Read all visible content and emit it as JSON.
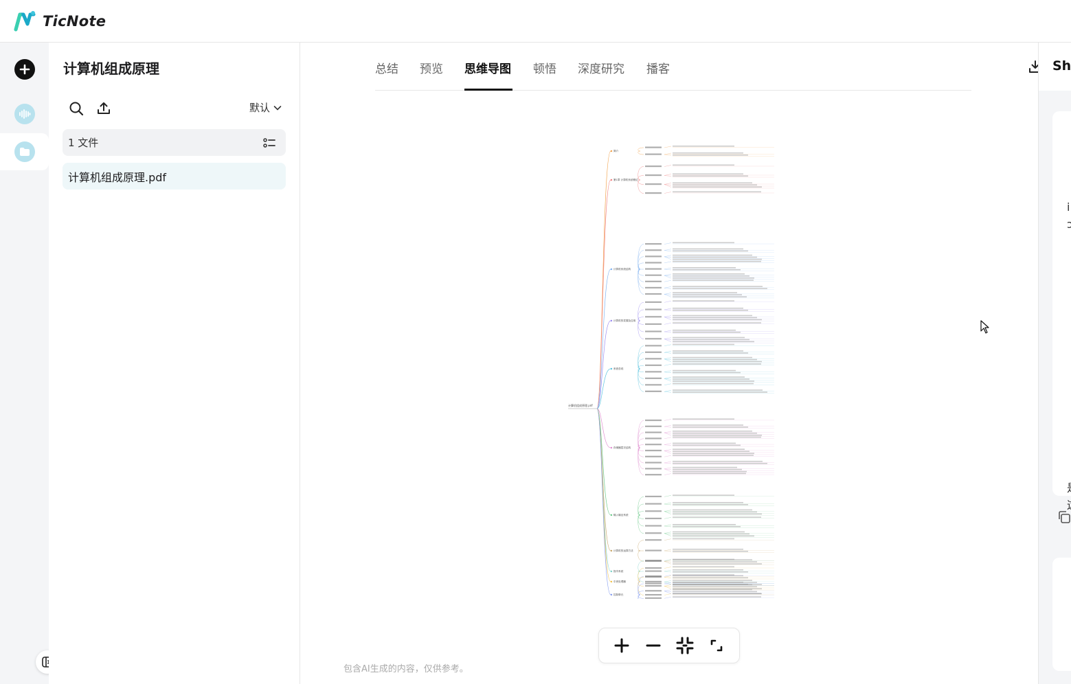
{
  "brand": {
    "name": "TicNote"
  },
  "folder": {
    "title": "计算机组成原理",
    "sort_label": "默认",
    "file_count": "1 文件",
    "files": [
      {
        "name": "计算机组成原理.pdf"
      }
    ]
  },
  "tabs": [
    {
      "label": "总结"
    },
    {
      "label": "预览"
    },
    {
      "label": "思维导图",
      "active": true
    },
    {
      "label": "顿悟"
    },
    {
      "label": "深度研究"
    },
    {
      "label": "播客"
    }
  ],
  "mindmap": {
    "root": "计算机组成原理.pdf",
    "branches": [
      {
        "label": "简介"
      },
      {
        "label": "第1章 计算机系统概论"
      },
      {
        "label": "计算机系统结构"
      },
      {
        "label": "计算机的发展及应用"
      },
      {
        "label": "系统总线"
      },
      {
        "label": "存储器层次结构"
      },
      {
        "label": "输入输出系统"
      },
      {
        "label": "计算机的运算方法"
      },
      {
        "label": "指令系统"
      },
      {
        "label": "中央处理器"
      },
      {
        "label": "控制单元"
      }
    ]
  },
  "disclaimer": "包含AI生成的内容，仅供参考。",
  "right_panel": {
    "title": "Sha",
    "visible_chars": [
      "i",
      "ɔ",
      "是",
      "这"
    ]
  },
  "colors": {
    "accent": "#3ec4dc",
    "active_tab": "#111111",
    "rail_bg": "#f4f5f7"
  }
}
